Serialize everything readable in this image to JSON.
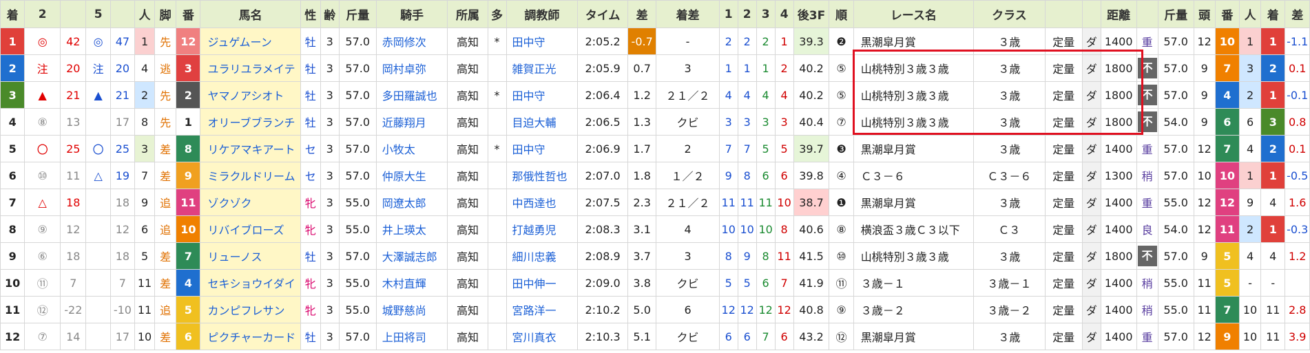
{
  "headers": [
    "着",
    "2",
    "",
    "5",
    "",
    "人",
    "脚",
    "番",
    "馬名",
    "性",
    "齢",
    "斤量",
    "騎手",
    "所属",
    "多",
    "調教師",
    "タイム",
    "差",
    "着差",
    "1",
    "2",
    "3",
    "4",
    "後3F",
    "順",
    "レース名",
    "クラス",
    "",
    "",
    "距離",
    "",
    "斤量",
    "頭",
    "番",
    "人",
    "着",
    "差"
  ],
  "rows": [
    {
      "rank": "1",
      "rank_color": "#e0403a",
      "m2": "◎",
      "m2_cls": "m-red",
      "v2": "42",
      "v2_cls": "m-red",
      "m5": "◎",
      "m5_cls": "m-blue",
      "v5": "47",
      "v5_cls": "m-blue",
      "pop": "1",
      "pop_bg": "#fbd0d0",
      "leg": "先",
      "leg_cls": "m-orange",
      "num": "12",
      "num_bg": "#f08080",
      "name": "ジュゲムーン",
      "sex": "牡",
      "sex_cls": "sex-m",
      "age": "3",
      "kin": "57.0",
      "jockey": "赤岡修次",
      "belong": "高知",
      "multi": "*",
      "trainer": "田中守",
      "time": "2:05.2",
      "diff": "-0.7",
      "diff_bg": "#e08000",
      "margin": "-",
      "c1": "2",
      "c2": "2",
      "c3": "2",
      "c4": "1",
      "last3f": "39.3",
      "last3f_bg": "#e6f5d8",
      "pos": "❷",
      "race": "黒潮皐月賞",
      "cls": "３歳",
      "cond": "定量",
      "surf": "ダ",
      "dist": "1400",
      "going": "重",
      "kin2": "57.0",
      "heads": "12",
      "num2": "10",
      "num2_bg": "#f08000",
      "pop2": "1",
      "pop2_bg": "#fbd0d0",
      "fin2": "1",
      "fin2_bg": "#e0403a",
      "diff2": "-1.1",
      "diff2_cls": "pace-pos"
    },
    {
      "rank": "2",
      "rank_color": "#1f6fcf",
      "m2": "注",
      "m2_cls": "m-red",
      "v2": "20",
      "v2_cls": "m-red",
      "m5": "注",
      "m5_cls": "m-blue",
      "v5": "20",
      "v5_cls": "m-blue",
      "pop": "4",
      "pop_bg": "#ffffff",
      "leg": "逃",
      "leg_cls": "m-orange",
      "num": "3",
      "num_bg": "#e04040",
      "name": "ユラリユラメイテ",
      "sex": "牡",
      "sex_cls": "sex-m",
      "age": "3",
      "kin": "57.0",
      "jockey": "岡村卓弥",
      "belong": "高知",
      "multi": "",
      "trainer": "雑賀正光",
      "time": "2:05.9",
      "diff": "0.7",
      "diff_bg": "#ffffff",
      "margin": "3",
      "c1": "1",
      "c2": "1",
      "c3": "1",
      "c4": "2",
      "last3f": "40.2",
      "last3f_bg": "#ffffff",
      "pos": "⑤",
      "race": "山桃特別３歳３歳",
      "cls": "３歳",
      "cond": "定量",
      "surf": "ダ",
      "dist": "1800",
      "going": "不",
      "kin2": "57.0",
      "heads": "9",
      "num2": "7",
      "num2_bg": "#f08000",
      "pop2": "3",
      "pop2_bg": "#cfe7ff",
      "fin2": "2",
      "fin2_bg": "#1f6fcf",
      "diff2": "0.1",
      "diff2_cls": "pace-neg"
    },
    {
      "rank": "3",
      "rank_color": "#4a8a2a",
      "m2": "▲",
      "m2_cls": "m-red",
      "v2": "21",
      "v2_cls": "m-red",
      "m5": "▲",
      "m5_cls": "m-blue",
      "v5": "21",
      "v5_cls": "m-blue",
      "pop": "2",
      "pop_bg": "#cfe7ff",
      "leg": "先",
      "leg_cls": "m-orange",
      "num": "2",
      "num_bg": "#555555",
      "name": "ヤマノアシオト",
      "sex": "牡",
      "sex_cls": "sex-m",
      "age": "3",
      "kin": "57.0",
      "jockey": "多田羅誠也",
      "belong": "高知",
      "multi": "*",
      "trainer": "田中守",
      "time": "2:06.4",
      "diff": "1.2",
      "diff_bg": "#ffffff",
      "margin": "２１／２",
      "c1": "4",
      "c2": "4",
      "c3": "4",
      "c4": "4",
      "last3f": "40.2",
      "last3f_bg": "#ffffff",
      "pos": "⑤",
      "race": "山桃特別３歳３歳",
      "cls": "３歳",
      "cond": "定量",
      "surf": "ダ",
      "dist": "1800",
      "going": "不",
      "kin2": "57.0",
      "heads": "9",
      "num2": "4",
      "num2_bg": "#1f6fcf",
      "pop2": "2",
      "pop2_bg": "#cfe7ff",
      "fin2": "1",
      "fin2_bg": "#e0403a",
      "diff2": "-0.1",
      "diff2_cls": "pace-pos"
    },
    {
      "rank": "4",
      "rank_color": "#ffffff",
      "m2": "⑧",
      "m2_cls": "muted",
      "v2": "13",
      "v2_cls": "muted",
      "m5": "",
      "m5_cls": "muted",
      "v5": "17",
      "v5_cls": "muted",
      "pop": "8",
      "pop_bg": "#ffffff",
      "leg": "先",
      "leg_cls": "m-orange",
      "num": "1",
      "num_bg": "#ffffff",
      "name": "オリーブブランチ",
      "sex": "牡",
      "sex_cls": "sex-m",
      "age": "3",
      "kin": "57.0",
      "jockey": "近藤翔月",
      "belong": "高知",
      "multi": "",
      "trainer": "目迫大輔",
      "time": "2:06.5",
      "diff": "1.3",
      "diff_bg": "#ffffff",
      "margin": "クビ",
      "c1": "3",
      "c2": "3",
      "c3": "3",
      "c4": "3",
      "last3f": "40.4",
      "last3f_bg": "#ffffff",
      "pos": "⑦",
      "race": "山桃特別３歳３歳",
      "cls": "３歳",
      "cond": "定量",
      "surf": "ダ",
      "dist": "1800",
      "going": "不",
      "kin2": "54.0",
      "heads": "9",
      "num2": "6",
      "num2_bg": "#2e8b57",
      "pop2": "6",
      "pop2_bg": "#ffffff",
      "fin2": "3",
      "fin2_bg": "#4a8a2a",
      "diff2": "0.8",
      "diff2_cls": "pace-neg"
    },
    {
      "rank": "5",
      "rank_color": "#ffffff",
      "m2": "〇",
      "m2_cls": "m-red",
      "v2": "25",
      "v2_cls": "m-red",
      "m5": "〇",
      "m5_cls": "m-blue",
      "v5": "25",
      "v5_cls": "m-blue",
      "pop": "3",
      "pop_bg": "#e7f3d3",
      "leg": "差",
      "leg_cls": "m-orange",
      "num": "8",
      "num_bg": "#2e8b57",
      "name": "リケアマキアート",
      "sex": "セ",
      "sex_cls": "sex-m",
      "age": "3",
      "kin": "57.0",
      "jockey": "小牧太",
      "belong": "高知",
      "multi": "*",
      "trainer": "田中守",
      "time": "2:06.9",
      "diff": "1.7",
      "diff_bg": "#ffffff",
      "margin": "2",
      "c1": "7",
      "c2": "7",
      "c3": "5",
      "c4": "5",
      "last3f": "39.7",
      "last3f_bg": "#e6f5d8",
      "pos": "❸",
      "race": "黒潮皐月賞",
      "cls": "３歳",
      "cond": "定量",
      "surf": "ダ",
      "dist": "1400",
      "going": "重",
      "kin2": "57.0",
      "heads": "12",
      "num2": "7",
      "num2_bg": "#2e8b57",
      "pop2": "4",
      "pop2_bg": "#ffffff",
      "fin2": "2",
      "fin2_bg": "#1f6fcf",
      "diff2": "0.1",
      "diff2_cls": "pace-neg"
    },
    {
      "rank": "6",
      "rank_color": "#ffffff",
      "m2": "⑩",
      "m2_cls": "muted",
      "v2": "11",
      "v2_cls": "muted",
      "m5": "△",
      "m5_cls": "m-blue",
      "v5": "19",
      "v5_cls": "m-blue",
      "pop": "7",
      "pop_bg": "#ffffff",
      "leg": "差",
      "leg_cls": "m-orange",
      "num": "9",
      "num_bg": "#f0a020",
      "name": "ミラクルドリーム",
      "sex": "セ",
      "sex_cls": "sex-m",
      "age": "3",
      "kin": "57.0",
      "jockey": "仲原大生",
      "belong": "高知",
      "multi": "",
      "trainer": "那俄性哲也",
      "time": "2:07.0",
      "diff": "1.8",
      "diff_bg": "#ffffff",
      "margin": "１／２",
      "c1": "9",
      "c2": "8",
      "c3": "6",
      "c4": "6",
      "last3f": "39.8",
      "last3f_bg": "#ffffff",
      "pos": "④",
      "race": "Ｃ３－６",
      "cls": "Ｃ３－６",
      "cond": "定量",
      "surf": "ダ",
      "dist": "1300",
      "going": "稍",
      "kin2": "57.0",
      "heads": "10",
      "num2": "10",
      "num2_bg": "#e04080",
      "pop2": "1",
      "pop2_bg": "#fbd0d0",
      "fin2": "1",
      "fin2_bg": "#e0403a",
      "diff2": "-0.5",
      "diff2_cls": "pace-pos"
    },
    {
      "rank": "7",
      "rank_color": "#ffffff",
      "m2": "△",
      "m2_cls": "m-red",
      "v2": "18",
      "v2_cls": "m-red",
      "m5": "",
      "m5_cls": "muted",
      "v5": "18",
      "v5_cls": "muted",
      "pop": "9",
      "pop_bg": "#ffffff",
      "leg": "追",
      "leg_cls": "m-orange",
      "num": "11",
      "num_bg": "#e04080",
      "name": "ゾクゾク",
      "sex": "牝",
      "sex_cls": "sex-f",
      "age": "3",
      "kin": "55.0",
      "jockey": "岡遼太郎",
      "belong": "高知",
      "multi": "",
      "trainer": "中西達也",
      "time": "2:07.5",
      "diff": "2.3",
      "diff_bg": "#ffffff",
      "margin": "２１／２",
      "c1": "11",
      "c2": "11",
      "c3": "11",
      "c4": "10",
      "last3f": "38.7",
      "last3f_bg": "#ffd0d0",
      "pos": "❶",
      "race": "黒潮皐月賞",
      "cls": "３歳",
      "cond": "定量",
      "surf": "ダ",
      "dist": "1400",
      "going": "重",
      "kin2": "55.0",
      "heads": "12",
      "num2": "12",
      "num2_bg": "#e04080",
      "pop2": "9",
      "pop2_bg": "#ffffff",
      "fin2": "4",
      "fin2_bg": "#ffffff",
      "diff2": "1.6",
      "diff2_cls": "pace-neg"
    },
    {
      "rank": "8",
      "rank_color": "#ffffff",
      "m2": "⑨",
      "m2_cls": "muted",
      "v2": "12",
      "v2_cls": "muted",
      "m5": "",
      "m5_cls": "muted",
      "v5": "12",
      "v5_cls": "muted",
      "pop": "6",
      "pop_bg": "#ffffff",
      "leg": "追",
      "leg_cls": "m-orange",
      "num": "10",
      "num_bg": "#f08000",
      "name": "リバイブローズ",
      "sex": "牝",
      "sex_cls": "sex-f",
      "age": "3",
      "kin": "55.0",
      "jockey": "井上瑛太",
      "belong": "高知",
      "multi": "",
      "trainer": "打越勇児",
      "time": "2:08.3",
      "diff": "3.1",
      "diff_bg": "#ffffff",
      "margin": "4",
      "c1": "10",
      "c2": "10",
      "c3": "10",
      "c4": "8",
      "last3f": "40.6",
      "last3f_bg": "#ffffff",
      "pos": "⑧",
      "race": "横浪盃３歳Ｃ３以下",
      "cls": "Ｃ３",
      "cond": "定量",
      "surf": "ダ",
      "dist": "1400",
      "going": "良",
      "kin2": "54.0",
      "heads": "12",
      "num2": "11",
      "num2_bg": "#e04080",
      "pop2": "2",
      "pop2_bg": "#cfe7ff",
      "fin2": "1",
      "fin2_bg": "#e0403a",
      "diff2": "-0.3",
      "diff2_cls": "pace-pos"
    },
    {
      "rank": "9",
      "rank_color": "#ffffff",
      "m2": "⑥",
      "m2_cls": "muted",
      "v2": "18",
      "v2_cls": "muted",
      "m5": "",
      "m5_cls": "muted",
      "v5": "18",
      "v5_cls": "muted",
      "pop": "5",
      "pop_bg": "#ffffff",
      "leg": "差",
      "leg_cls": "m-orange",
      "num": "7",
      "num_bg": "#2e8b57",
      "name": "リューノス",
      "sex": "牡",
      "sex_cls": "sex-m",
      "age": "3",
      "kin": "57.0",
      "jockey": "大澤誠志郎",
      "belong": "高知",
      "multi": "",
      "trainer": "細川忠義",
      "time": "2:08.9",
      "diff": "3.7",
      "diff_bg": "#ffffff",
      "margin": "3",
      "c1": "8",
      "c2": "9",
      "c3": "8",
      "c4": "11",
      "last3f": "41.5",
      "last3f_bg": "#ffffff",
      "pos": "⑩",
      "race": "山桃特別３歳３歳",
      "cls": "３歳",
      "cond": "定量",
      "surf": "ダ",
      "dist": "1800",
      "going": "不",
      "kin2": "57.0",
      "heads": "9",
      "num2": "5",
      "num2_bg": "#f0c020",
      "pop2": "4",
      "pop2_bg": "#ffffff",
      "fin2": "4",
      "fin2_bg": "#ffffff",
      "diff2": "1.2",
      "diff2_cls": "pace-neg"
    },
    {
      "rank": "10",
      "rank_color": "#ffffff",
      "m2": "⑪",
      "m2_cls": "muted",
      "v2": "7",
      "v2_cls": "muted",
      "m5": "",
      "m5_cls": "muted",
      "v5": "7",
      "v5_cls": "muted",
      "pop": "11",
      "pop_bg": "#ffffff",
      "leg": "差",
      "leg_cls": "m-orange",
      "num": "4",
      "num_bg": "#1f6fcf",
      "name": "セキショウイダイ",
      "sex": "牝",
      "sex_cls": "sex-f",
      "age": "3",
      "kin": "55.0",
      "jockey": "木村直輝",
      "belong": "高知",
      "multi": "",
      "trainer": "田中伸一",
      "time": "2:09.0",
      "diff": "3.8",
      "diff_bg": "#ffffff",
      "margin": "クビ",
      "c1": "5",
      "c2": "5",
      "c3": "6",
      "c4": "7",
      "last3f": "41.9",
      "last3f_bg": "#ffffff",
      "pos": "⑪",
      "race": "３歳－１",
      "cls": "３歳－１",
      "cond": "定量",
      "surf": "ダ",
      "dist": "1400",
      "going": "稍",
      "kin2": "55.0",
      "heads": "11",
      "num2": "5",
      "num2_bg": "#f0c020",
      "pop2": "-",
      "pop2_bg": "#ffffff",
      "fin2": "-",
      "fin2_bg": "#ffffff",
      "diff2": "",
      "diff2_cls": "pace-neg"
    },
    {
      "rank": "11",
      "rank_color": "#ffffff",
      "m2": "⑫",
      "m2_cls": "muted",
      "v2": "-22",
      "v2_cls": "muted",
      "m5": "",
      "m5_cls": "muted",
      "v5": "-10",
      "v5_cls": "muted",
      "pop": "11",
      "pop_bg": "#ffffff",
      "leg": "追",
      "leg_cls": "m-orange",
      "num": "5",
      "num_bg": "#f0c020",
      "name": "カンピフレサン",
      "sex": "牝",
      "sex_cls": "sex-f",
      "age": "3",
      "kin": "55.0",
      "jockey": "城野慈尚",
      "belong": "高知",
      "multi": "",
      "trainer": "宮路洋一",
      "time": "2:10.2",
      "diff": "5.0",
      "diff_bg": "#ffffff",
      "margin": "6",
      "c1": "12",
      "c2": "12",
      "c3": "12",
      "c4": "12",
      "last3f": "40.8",
      "last3f_bg": "#ffffff",
      "pos": "⑨",
      "race": "３歳－２",
      "cls": "３歳－２",
      "cond": "定量",
      "surf": "ダ",
      "dist": "1400",
      "going": "稍",
      "kin2": "55.0",
      "heads": "11",
      "num2": "7",
      "num2_bg": "#2e8b57",
      "pop2": "10",
      "pop2_bg": "#ffffff",
      "fin2": "11",
      "fin2_bg": "#ffffff",
      "diff2": "2.8",
      "diff2_cls": "pace-neg"
    },
    {
      "rank": "12",
      "rank_color": "#ffffff",
      "m2": "⑦",
      "m2_cls": "muted",
      "v2": "14",
      "v2_cls": "muted",
      "m5": "",
      "m5_cls": "muted",
      "v5": "17",
      "v5_cls": "muted",
      "pop": "10",
      "pop_bg": "#ffffff",
      "leg": "差",
      "leg_cls": "m-orange",
      "num": "6",
      "num_bg": "#f0c020",
      "name": "ピクチャーカード",
      "sex": "牡",
      "sex_cls": "sex-m",
      "age": "3",
      "kin": "57.0",
      "jockey": "上田将司",
      "belong": "高知",
      "multi": "",
      "trainer": "宮川真衣",
      "time": "2:10.3",
      "diff": "5.1",
      "diff_bg": "#ffffff",
      "margin": "クビ",
      "c1": "6",
      "c2": "6",
      "c3": "7",
      "c4": "6",
      "last3f": "43.2",
      "last3f_bg": "#ffffff",
      "pos": "⑫",
      "race": "黒潮皐月賞",
      "cls": "３歳",
      "cond": "定量",
      "surf": "ダ",
      "dist": "1400",
      "going": "重",
      "kin2": "57.0",
      "heads": "12",
      "num2": "9",
      "num2_bg": "#f08000",
      "pop2": "10",
      "pop2_bg": "#ffffff",
      "fin2": "11",
      "fin2_bg": "#ffffff",
      "diff2": "3.9",
      "diff2_cls": "pace-neg"
    }
  ]
}
